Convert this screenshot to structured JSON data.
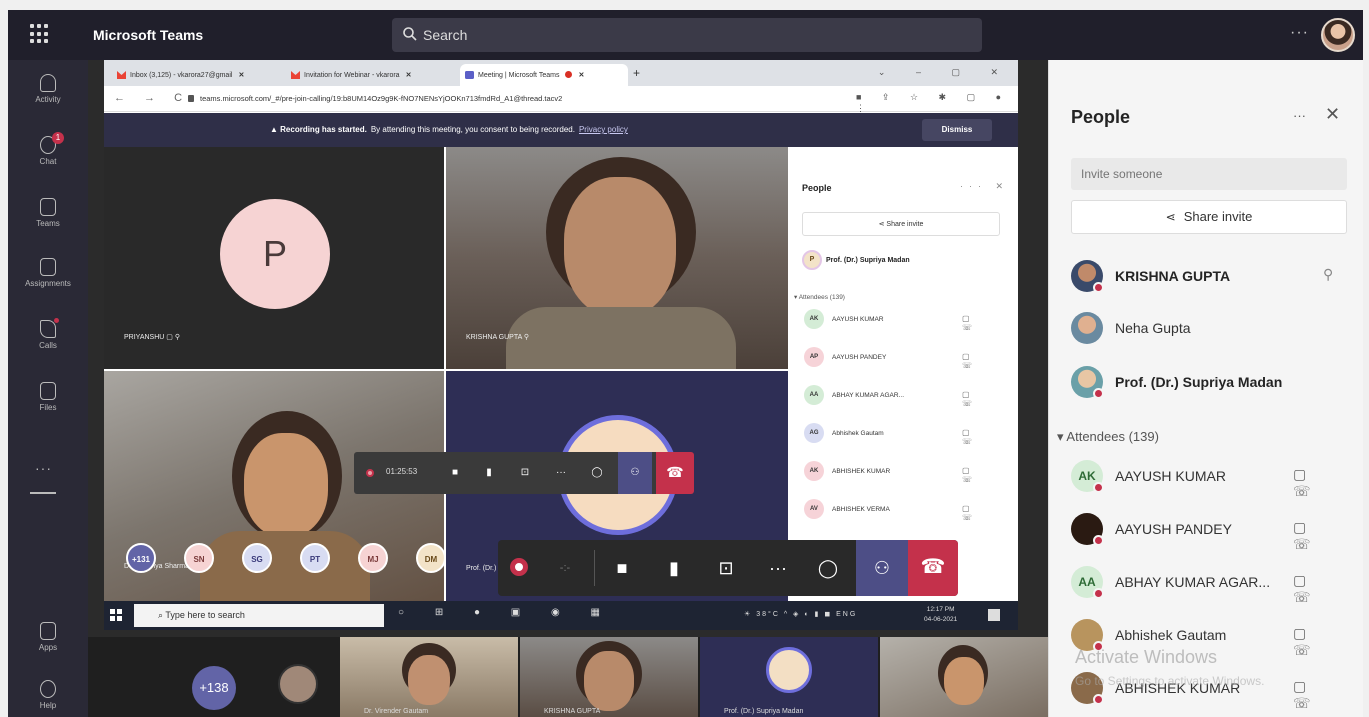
{
  "app": {
    "title": "Microsoft Teams"
  },
  "search": {
    "placeholder": "Search"
  },
  "rail": {
    "items": [
      {
        "label": "Activity",
        "icon": "bell-icon"
      },
      {
        "label": "Chat",
        "icon": "chat-icon",
        "badge": "1"
      },
      {
        "label": "Teams",
        "icon": "teams-icon"
      },
      {
        "label": "Assignments",
        "icon": "assignments-icon"
      },
      {
        "label": "Calls",
        "icon": "phone-icon"
      },
      {
        "label": "Files",
        "icon": "file-icon"
      },
      {
        "label": "Apps",
        "icon": "apps-icon"
      },
      {
        "label": "Help",
        "icon": "help-icon"
      }
    ],
    "more": "···"
  },
  "browser": {
    "tabs": [
      {
        "label": "Inbox (3,125) - vkarora27@gmail",
        "icon": "gmail-icon"
      },
      {
        "label": "Invitation for Webinar - vkarora",
        "icon": "gmail-icon"
      },
      {
        "label": "Meeting | Microsoft Teams",
        "icon": "teams-icon"
      }
    ],
    "url": "teams.microsoft.com/_#/pre-join-calling/19:b8UM14Oz9g9K-fNO7NENsYjOOKn713fmdRd_A1@thread.tacv2",
    "banner": {
      "bold": "Recording has started.",
      "text": "By attending this meeting, you consent to being recorded.",
      "link": "Privacy policy",
      "dismiss": "Dismiss"
    }
  },
  "tiles": {
    "t1_initial": "P",
    "t1_name": "PRIYANSHU",
    "t2_name": "KRISHNA GUPTA",
    "t3_name": "Dr. Sandhya Sharma",
    "t4_name": "Prof. (Dr.) Supriya Madan"
  },
  "inner_people": {
    "title": "People",
    "share": "Share invite",
    "organizer": {
      "initial": "P",
      "name": "Prof. (Dr.) Supriya Madan"
    },
    "attendees_label": "Attendees (139)",
    "rows": [
      {
        "initials": "AK",
        "name": "AAYUSH KUMAR",
        "color": "#d4ecd6"
      },
      {
        "initials": "AP",
        "name": "AAYUSH PANDEY",
        "color": "#f6d3d8"
      },
      {
        "initials": "AA",
        "name": "ABHAY KUMAR AGAR...",
        "color": "#d4ecd6"
      },
      {
        "initials": "AG",
        "name": "Abhishek Gautam",
        "color": "#d8dcf2"
      },
      {
        "initials": "AK",
        "name": "ABHISHEK KUMAR",
        "color": "#f6d3d8"
      },
      {
        "initials": "AV",
        "name": "ABHISHEK VERMA",
        "color": "#f6d3d8"
      }
    ]
  },
  "small_bar": {
    "timer": "01:25:53"
  },
  "chips": [
    {
      "label": "+131",
      "color": "#6264a7",
      "fg": "#ffffff"
    },
    {
      "label": "SN",
      "color": "#f6d3d3",
      "fg": "#7a3a3a"
    },
    {
      "label": "SG",
      "color": "#d8dcf2",
      "fg": "#3a3a7a"
    },
    {
      "label": "PT",
      "color": "#d8dcf2",
      "fg": "#3a3a7a"
    },
    {
      "label": "MJ",
      "color": "#f6d3d3",
      "fg": "#7a3a3a"
    },
    {
      "label": "DM",
      "color": "#f3e3c8",
      "fg": "#6a4a1a"
    }
  ],
  "taskbar": {
    "search": "Type here to search",
    "weather": "38°C",
    "lang": "ENG",
    "time": "12:17 PM",
    "date": "04-06-2021"
  },
  "gallery": {
    "count": "+138",
    "labels": [
      "Dr. Virender Gautam",
      "KRISHNA GUPTA",
      "Prof. (Dr.) Supriya Madan"
    ]
  },
  "panel": {
    "title": "People",
    "invite_placeholder": "Invite someone",
    "share": "Share invite",
    "presenters": [
      {
        "name": "KRISHNA GUPTA",
        "bold": true,
        "muted": true
      },
      {
        "name": "Neha Gupta",
        "bold": false
      },
      {
        "name": "Prof. (Dr.) Supriya Madan",
        "bold": true
      }
    ],
    "attendees_label": "Attendees (139)",
    "attendees": [
      {
        "initials": "AK",
        "name": "AAYUSH KUMAR",
        "color": "#d4ecd6",
        "fg": "#2e6b36"
      },
      {
        "initials": "",
        "name": "AAYUSH PANDEY",
        "color": "#2a1a12",
        "fg": "#ffffff"
      },
      {
        "initials": "AA",
        "name": "ABHAY KUMAR AGAR...",
        "color": "#d4ecd6",
        "fg": "#2e6b36"
      },
      {
        "initials": "",
        "name": "Abhishek Gautam",
        "color": "#b8945e",
        "fg": "#ffffff"
      },
      {
        "initials": "",
        "name": "ABHISHEK KUMAR",
        "color": "#8a6a4a",
        "fg": "#ffffff"
      }
    ]
  },
  "watermark": {
    "title": "Activate Windows",
    "sub": "Go to Settings to activate Windows."
  }
}
